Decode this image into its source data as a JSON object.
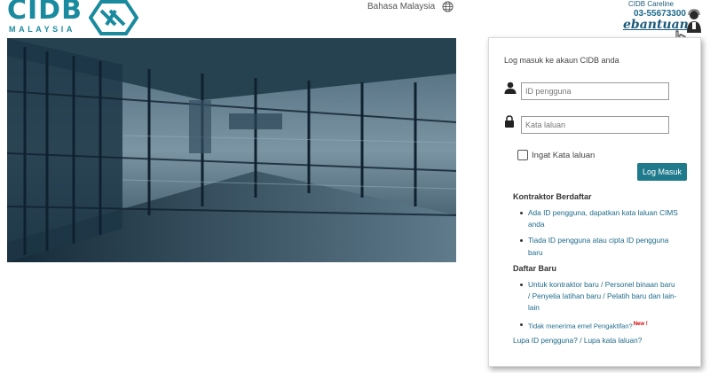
{
  "header": {
    "logo": {
      "text": "CIDB",
      "subtext": "MALAYSIA"
    },
    "language_label": "Bahasa Malaysia",
    "careline": {
      "title": "CIDB Careline",
      "phone": "03-55673300",
      "brand": "ebantuan"
    }
  },
  "hero": {
    "description": "glass building corridor photo"
  },
  "login": {
    "title": "Log masuk ke akaun CIDB anda",
    "username_placeholder": "ID pengguna",
    "password_placeholder": "Kata laluan",
    "remember_label": "Ingat Kata laluan",
    "login_button": "Log Masuk"
  },
  "registered": {
    "heading": "Kontraktor Berdaftar",
    "links": [
      "Ada ID pengguna, dapatkan kata laluan CIMS anda",
      "Tiada ID pengguna atau cipta ID pengguna baru"
    ]
  },
  "new_registration": {
    "heading": "Daftar Baru",
    "links": [
      "Untuk kontraktor baru / Personel binaan baru / Penyelia latihan baru / Pelatih baru dan lain-lain",
      "Tidak menerima emel Pengaktifan?"
    ],
    "new_badge": "New !"
  },
  "footer_links": {
    "forgot_id": "Lupa ID pengguna?",
    "separator": " / ",
    "forgot_password": "Lupa kata laluan?"
  },
  "colors": {
    "brand": "#1a8a9e",
    "button": "#1f7a8c",
    "link": "#1d6a8a"
  }
}
